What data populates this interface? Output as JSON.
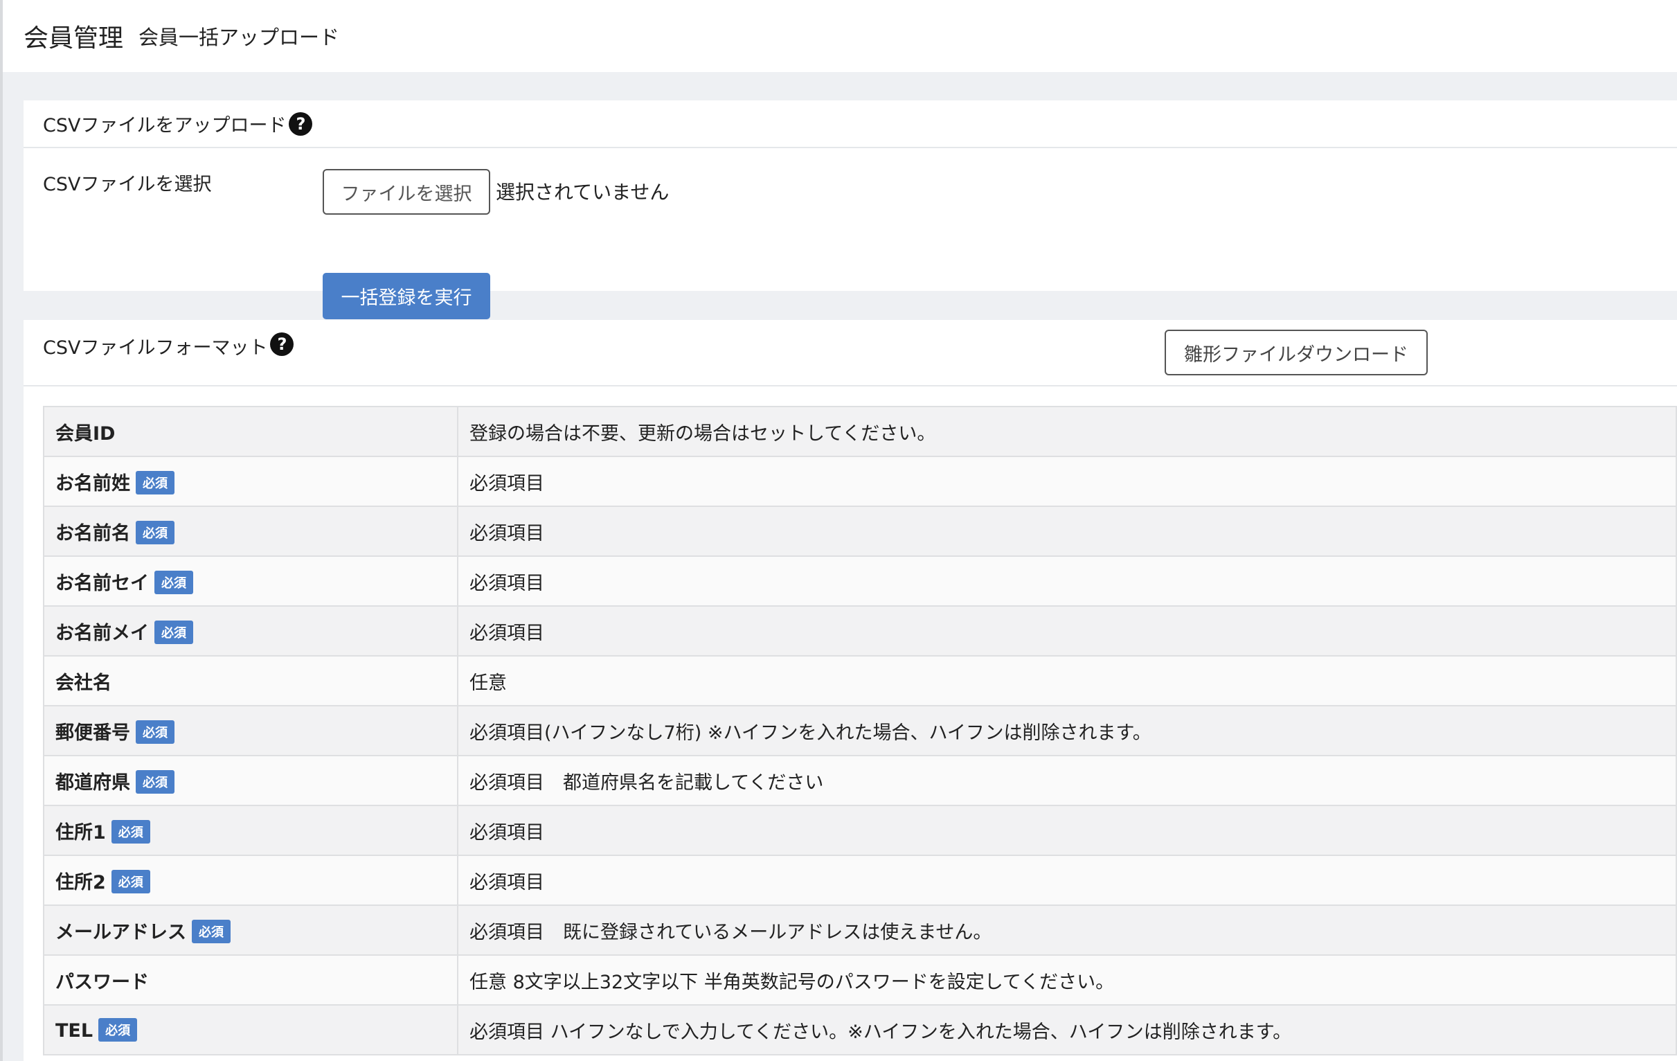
{
  "header": {
    "title": "会員管理",
    "subtitle": "会員一括アップロード"
  },
  "upload": {
    "title": "CSVファイルをアップロード",
    "help_icon": "question-circle",
    "file_label": "CSVファイルを選択",
    "file_button": "ファイルを選択",
    "file_status": "選択されていません",
    "submit_button": "一括登録を実行"
  },
  "format": {
    "title": "CSVファイルフォーマット",
    "help_icon": "question-circle",
    "template_button": "雛形ファイルダウンロード",
    "required_badge": "必須",
    "rows": [
      {
        "name": "会員ID",
        "required": false,
        "description": "登録の場合は不要、更新の場合はセットしてください。"
      },
      {
        "name": "お名前姓",
        "required": true,
        "description": "必須項目"
      },
      {
        "name": "お名前名",
        "required": true,
        "description": "必須項目"
      },
      {
        "name": "お名前セイ",
        "required": true,
        "description": "必須項目"
      },
      {
        "name": "お名前メイ",
        "required": true,
        "description": "必須項目"
      },
      {
        "name": "会社名",
        "required": false,
        "description": "任意"
      },
      {
        "name": "郵便番号",
        "required": true,
        "description": "必須項目(ハイフンなし7桁) ※ハイフンを入れた場合、ハイフンは削除されます。"
      },
      {
        "name": "都道府県",
        "required": true,
        "description": "必須項目　都道府県名を記載してください"
      },
      {
        "name": "住所1",
        "required": true,
        "description": "必須項目"
      },
      {
        "name": "住所2",
        "required": true,
        "description": "必須項目"
      },
      {
        "name": "メールアドレス",
        "required": true,
        "description": "必須項目　既に登録されているメールアドレスは使えません。"
      },
      {
        "name": "パスワード",
        "required": false,
        "description": "任意 8文字以上32文字以下 半角英数記号のパスワードを設定してください。"
      },
      {
        "name": "TEL",
        "required": true,
        "description": "必須項目 ハイフンなしで入力してください。※ハイフンを入れた場合、ハイフンは削除されます。"
      }
    ]
  }
}
